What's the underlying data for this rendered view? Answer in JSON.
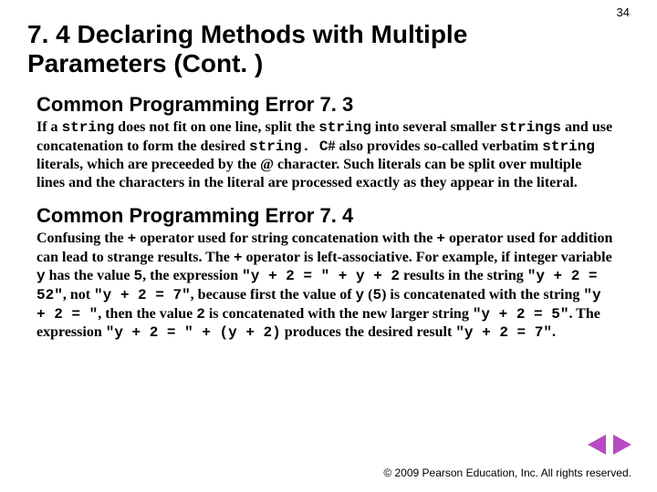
{
  "page_number": "34",
  "title": "7. 4  Declaring Methods with Multiple Parameters (Cont. )",
  "err73": {
    "heading": "Common Programming Error 7. 3",
    "t1": "If a ",
    "c1": "string",
    "t2": " does not fit on one line, split the ",
    "c2": "string",
    "t3": " into several smaller ",
    "c3": "strings",
    "t4": " and use concatenation to form the desired ",
    "c4": "string. C",
    "t5": "# also provides so-called verbatim ",
    "c5": "string",
    "t6": " literals, which are preceeded by the @ character. Such literals can be split over multiple lines and the characters in the literal are processed exactly as they appear in the literal."
  },
  "err74": {
    "heading": "Common Programming Error 7. 4",
    "t1": "Confusing the ",
    "c1": "+",
    "t2": " operator used for string concatenation with the ",
    "c2": "+",
    "t3": " operator used for addition can lead to strange results. The ",
    "c3": "+",
    "t4": " operator is left-associative. For example, if integer variable ",
    "c4": "y",
    "t5": " has the value ",
    "c5": "5",
    "t6": ", the expression ",
    "c6": "\"y + 2 = \" + y + 2",
    "t7": " results in the string ",
    "c7": "\"y + 2 = 52\"",
    "t8": ", not ",
    "c8": "\"y + 2 = 7\"",
    "t9": ", because first the value of ",
    "c9": "y",
    "t10": " (",
    "c10": "5",
    "t11": ") is concatenated with the string ",
    "c11": "\"y + 2 = \"",
    "t12": ", then the value ",
    "c12": "2",
    "t13": " is concatenated with the new larger string ",
    "c13": "\"y + 2 = 5\"",
    "t14": ". The expression ",
    "c14": "\"y + 2 = \" + (y + 2)",
    "t15": " produces the desired result ",
    "c15": "\"y + 2 = 7\"",
    "t16": "."
  },
  "copyright": "© 2009 Pearson Education, Inc.  All rights reserved."
}
